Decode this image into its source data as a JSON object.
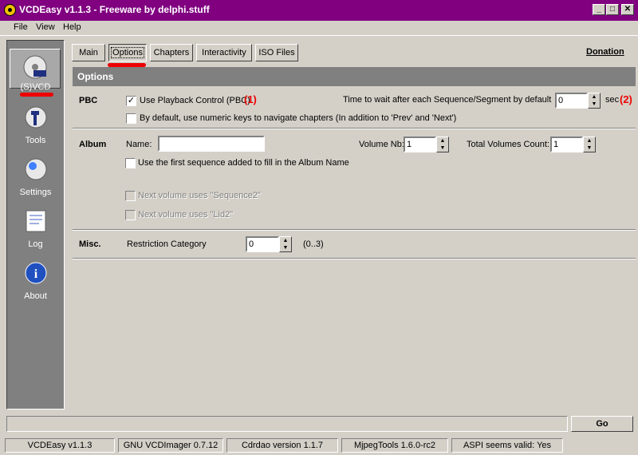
{
  "window": {
    "title": "VCDEasy v1.1.3 - Freeware by delphi.stuff"
  },
  "menu": {
    "file": "File",
    "view": "View",
    "help": "Help"
  },
  "nav": [
    {
      "label": "(S)VCD",
      "icon": "svcd-disc-icon"
    },
    {
      "label": "Tools",
      "icon": "tools-icon"
    },
    {
      "label": "Settings",
      "icon": "settings-icon"
    },
    {
      "label": "Log",
      "icon": "log-icon"
    },
    {
      "label": "About",
      "icon": "about-icon"
    }
  ],
  "tabs": [
    "Main",
    "Options",
    "Chapters",
    "Interactivity",
    "ISO Files"
  ],
  "donation": "Donation",
  "section_title": "Options",
  "pbc": {
    "title": "PBC",
    "use_pbc_label": "Use Playback Control (PBC)",
    "use_pbc_checked": true,
    "marker1": "(1)",
    "wait_label": "Time to wait after each Sequence/Segment by default",
    "wait_value": "0",
    "sec_label": "sec",
    "marker2": "(2)",
    "numeric_keys_label": "By default, use numeric keys to navigate chapters (In addition to 'Prev' and 'Next')"
  },
  "album": {
    "title": "Album",
    "name_label": "Name:",
    "name_value": "",
    "volume_nb_label": "Volume Nb:",
    "volume_nb_value": "1",
    "total_label": "Total Volumes Count:",
    "total_value": "1",
    "first_seq_label": "Use the first sequence added to fill in the Album Name",
    "next_seq_label": "Next volume uses \"Sequence2\"",
    "next_lid_label": "Next volume uses \"Lid2\""
  },
  "misc": {
    "title": "Misc.",
    "restriction_label": "Restriction Category",
    "restriction_value": "0",
    "range": "(0..3)"
  },
  "go_label": "Go",
  "status": [
    "VCDEasy v1.1.3",
    "GNU VCDImager 0.7.12",
    "Cdrdao version 1.1.7",
    "MjpegTools 1.6.0-rc2",
    "ASPI seems valid: Yes"
  ],
  "colors": {
    "titlebar": "#800080",
    "annotation": "#e00000",
    "face": "#d4d0c8",
    "nav": "#808080"
  }
}
